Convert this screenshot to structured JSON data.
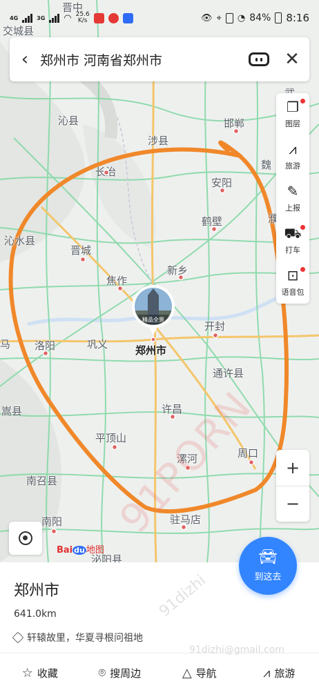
{
  "status_bar": {
    "network": "4G",
    "network2": "3G",
    "speed_value": "25.6",
    "speed_unit": "K/s",
    "battery": "84%",
    "time": "8:16"
  },
  "search": {
    "back_icon": "chevron-left-icon",
    "title": "郑州市 河南省郑州市",
    "robot_icon": "robot-icon",
    "close_icon": "close-icon"
  },
  "right_tools": [
    {
      "label": "图层",
      "icon": "layers-icon",
      "badge": true
    },
    {
      "label": "旅游",
      "icon": "travel-icon",
      "badge": false
    },
    {
      "label": "上报",
      "icon": "report-icon",
      "badge": false
    },
    {
      "label": "打车",
      "icon": "taxi-icon",
      "badge": true
    },
    {
      "label": "语音包",
      "icon": "voice-pack-icon",
      "badge": true
    }
  ],
  "zoom": {
    "in": "+",
    "out": "−"
  },
  "map": {
    "cities": [
      {
        "name": "晋中"
      },
      {
        "name": "交城县"
      },
      {
        "name": "沁县"
      },
      {
        "name": "涉县"
      },
      {
        "name": "邯郸"
      },
      {
        "name": "长治"
      },
      {
        "name": "安阳"
      },
      {
        "name": "鹤壁"
      },
      {
        "name": "沁水县"
      },
      {
        "name": "晋城"
      },
      {
        "name": "新乡"
      },
      {
        "name": "焦作"
      },
      {
        "name": "开封"
      },
      {
        "name": "洛阳"
      },
      {
        "name": "巩义"
      },
      {
        "name": "通许县"
      },
      {
        "name": "嵩县"
      },
      {
        "name": "许昌"
      },
      {
        "name": "平顶山"
      },
      {
        "name": "漯河"
      },
      {
        "name": "周口"
      },
      {
        "name": "南召县"
      },
      {
        "name": "南阳"
      },
      {
        "name": "驻马店"
      },
      {
        "name": "泌阳县"
      },
      {
        "name": "魏"
      },
      {
        "name": "濮"
      },
      {
        "name": "马"
      },
      {
        "name": "武"
      }
    ],
    "center_city": "郑州市",
    "photo_label": "精品全景",
    "logo": {
      "b": "Bai",
      "d": "du",
      "m": "地图"
    }
  },
  "goto_button": {
    "label": "到这去",
    "icon": "car-icon"
  },
  "panel": {
    "title": "郑州市",
    "distance": "641.0km",
    "description": "轩辕故里，华夏寻根问祖地",
    "actions": [
      {
        "label": "收藏",
        "icon": "star-icon"
      },
      {
        "label": "搜周边",
        "icon": "location-pin-icon"
      },
      {
        "label": "导航",
        "icon": "navigation-icon"
      },
      {
        "label": "旅游",
        "icon": "travel-icon"
      }
    ]
  },
  "watermarks": {
    "big": "91PORN",
    "mid": "91dizhi",
    "email": "91dizhi@gmail.com"
  },
  "colors": {
    "accent": "#3385ff",
    "road": "#7fd7a2",
    "highway": "#f4c56a",
    "annotation": "#f0882a",
    "city_dot": "#e06262"
  }
}
